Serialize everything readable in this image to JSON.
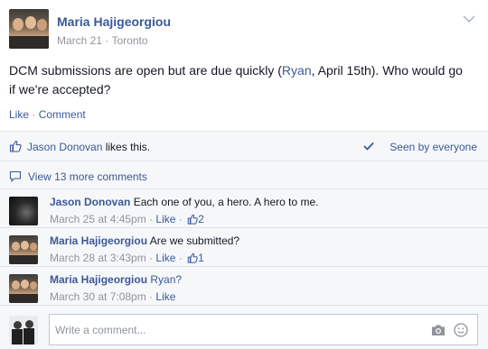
{
  "post": {
    "author": "Maria Hajigeorgiou",
    "date": "March 21",
    "location": "Toronto",
    "meta_separator": " · ",
    "text_before": "DCM submissions are open but are due quickly (",
    "mention": "Ryan",
    "text_after": ", April 15th). Who would go if we're accepted?",
    "actions": {
      "like": "Like",
      "separator": " · ",
      "comment": "Comment"
    }
  },
  "likes": {
    "liker": "Jason Donovan",
    "suffix": " likes this.",
    "seen": "Seen by everyone"
  },
  "more_comments": "View 13 more comments",
  "comments": [
    {
      "author": "Jason Donovan",
      "text": "Each one of you, a hero. A hero to me.",
      "time": "March 25 at 4:45pm",
      "like": "Like",
      "like_count": "2"
    },
    {
      "author": "Maria Hajigeorgiou",
      "text": "Are we submitted?",
      "time": "March 28 at 3:43pm",
      "like": "Like",
      "like_count": "1"
    },
    {
      "author": "Maria Hajigeorgiou",
      "text": "Ryan?",
      "time": "March 30 at 7:08pm",
      "like": "Like"
    }
  ],
  "meta_dot": " · ",
  "compose": {
    "placeholder": "Write a comment..."
  },
  "colors": {
    "link": "#3b5998",
    "muted": "#90949c",
    "ufi_bg": "#f6f7f9"
  }
}
